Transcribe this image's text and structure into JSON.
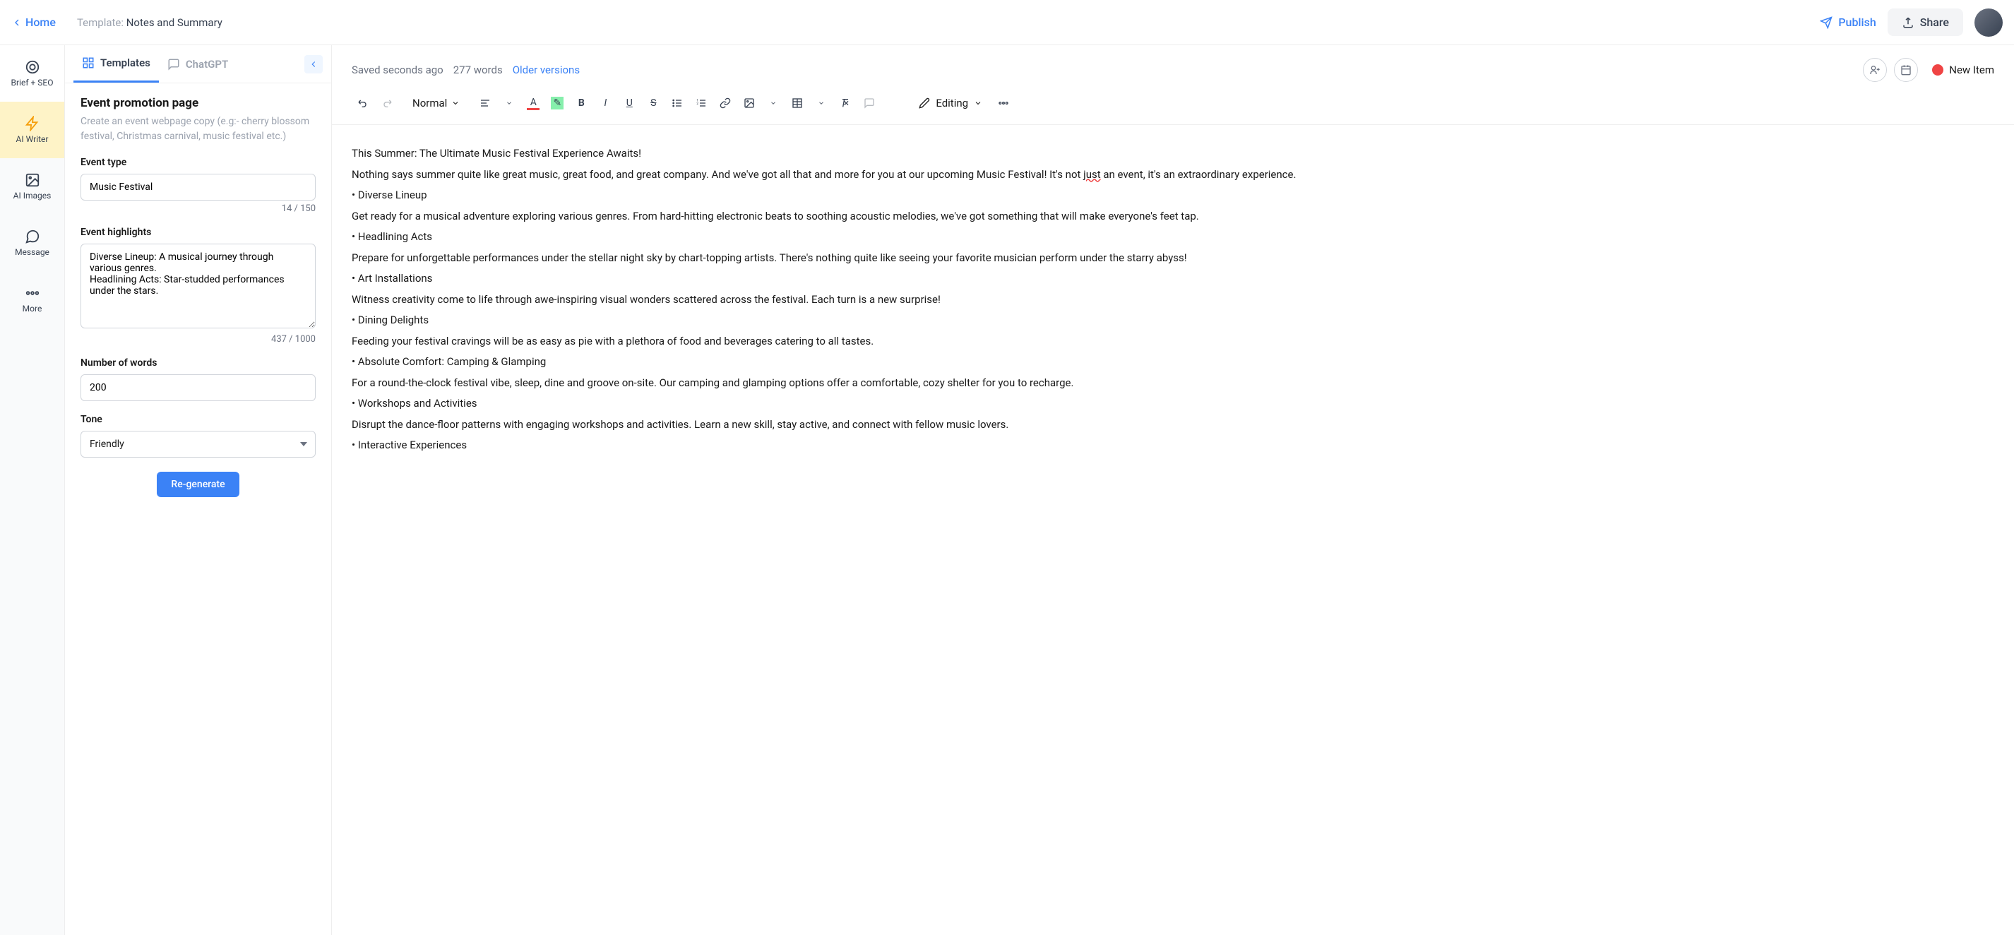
{
  "topbar": {
    "home": "Home",
    "template_prefix": "Template: ",
    "template_name": "Notes and Summary",
    "publish": "Publish",
    "share": "Share"
  },
  "rail": {
    "items": [
      {
        "label": "Brief + SEO"
      },
      {
        "label": "AI Writer"
      },
      {
        "label": "AI Images"
      },
      {
        "label": "Message"
      },
      {
        "label": "More"
      }
    ]
  },
  "tabs": {
    "templates": "Templates",
    "chatgpt": "ChatGPT"
  },
  "form": {
    "title": "Event promotion page",
    "desc": "Create an event webpage copy (e.g:- cherry blossom festival, Christmas carnival, music festival etc.)",
    "event_type_label": "Event type",
    "event_type_value": "Music Festival",
    "event_type_counter": "14 / 150",
    "highlights_label": "Event highlights",
    "highlights_value": "Diverse Lineup: A musical journey through various genres.\nHeadlining Acts: Star-studded performances under the stars.",
    "highlights_counter": "437 / 1000",
    "words_label": "Number of words",
    "words_value": "200",
    "tone_label": "Tone",
    "tone_value": "Friendly",
    "regenerate": "Re-generate"
  },
  "editor_meta": {
    "status": "Saved seconds ago",
    "word_count": "277 words",
    "older_versions": "Older versions",
    "new_item": "New Item",
    "editing_mode": "Editing",
    "para_style": "Normal"
  },
  "content": {
    "p1": "This Summer: The Ultimate Music Festival Experience Awaits!",
    "p2a": "Nothing says summer quite like great music, great food, and great company. And we've got all that and more for you at our upcoming Music Festival! It's not ",
    "p2_just": "just",
    "p2b": " an event, it's an extraordinary experience.",
    "b1": "• Diverse Lineup",
    "p3": "Get ready for a musical adventure exploring various genres. From hard-hitting electronic beats to soothing acoustic melodies, we've got something that will make everyone's feet tap.",
    "b2": "• Headlining Acts",
    "p4": "Prepare for unforgettable performances under the stellar night sky by chart-topping artists. There's nothing quite like seeing your favorite musician perform under the starry abyss!",
    "b3": "• Art Installations",
    "p5": "Witness creativity come to life through awe-inspiring visual wonders scattered across the festival. Each turn is a new surprise!",
    "b4": "• Dining Delights",
    "p6": "Feeding your festival cravings will be as easy as pie with a plethora of food and beverages catering to all tastes.",
    "b5": "• Absolute Comfort: Camping & Glamping",
    "p7": "For a round-the-clock festival vibe, sleep, dine and groove on-site. Our camping and glamping options offer a comfortable, cozy shelter for you to recharge.",
    "b6": "• Workshops and Activities",
    "p8": "Disrupt the dance-floor patterns with engaging workshops and activities. Learn a new skill, stay active, and connect with fellow music lovers.",
    "b7": "• Interactive Experiences"
  }
}
